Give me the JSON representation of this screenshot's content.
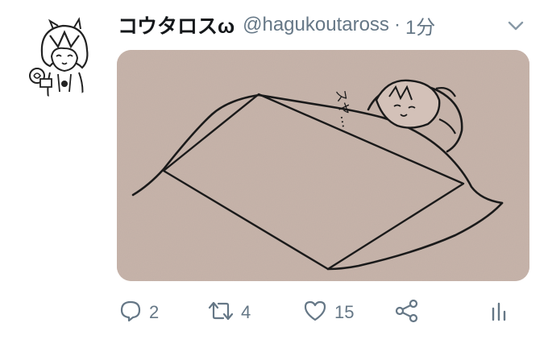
{
  "tweet": {
    "display_name": "コウタロスω",
    "handle": "@hagukoutaross",
    "separator": "·",
    "time": "1分"
  },
  "media": {
    "sfx_text": "スヤ…"
  },
  "actions": {
    "reply_count": "2",
    "retweet_count": "4",
    "like_count": "15"
  },
  "icons": {
    "reply": "reply-icon",
    "retweet": "retweet-icon",
    "like": "heart-icon",
    "share": "share-icon",
    "analytics": "analytics-icon",
    "caret": "chevron-down-icon"
  },
  "colors": {
    "text_primary": "#14171a",
    "text_secondary": "#657786",
    "paper": "#c9b5ab"
  }
}
